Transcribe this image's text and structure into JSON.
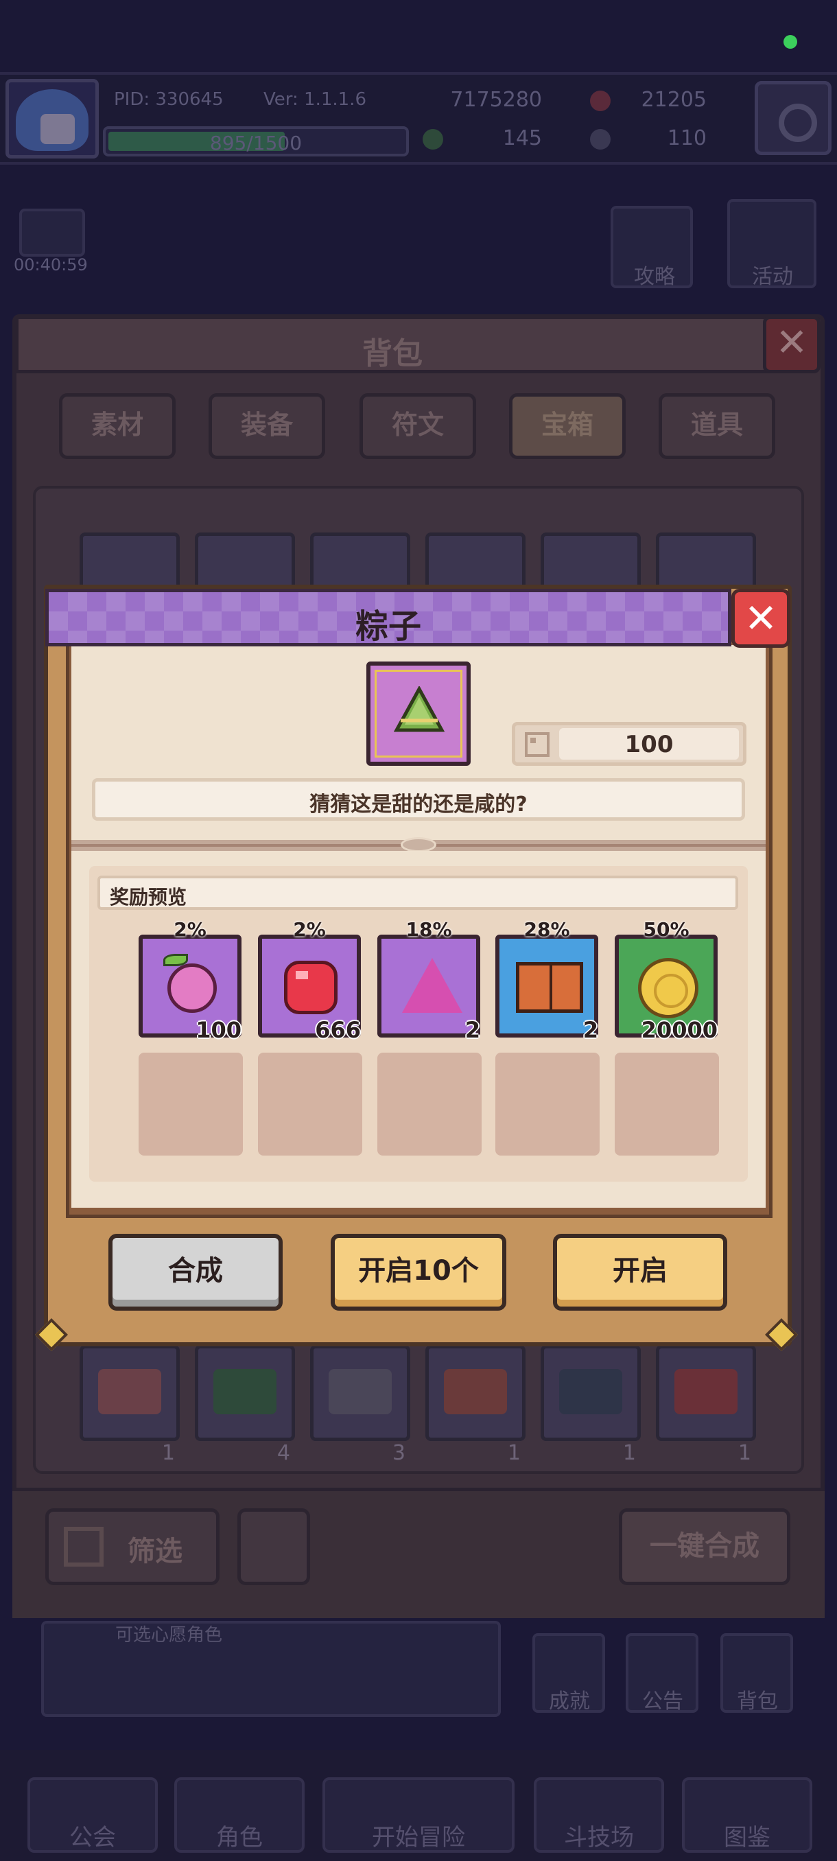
{
  "hud": {
    "pid": "PID: 330645",
    "version": "Ver: 1.1.1.6",
    "xp": "895/1500",
    "xp_fraction": 0.597,
    "gold": "7175280",
    "gems": "21205",
    "clovers": "145",
    "keys": "110",
    "timer": "00:40:59",
    "guide_label": "攻略",
    "event_label": "活动"
  },
  "backpack": {
    "title": "背包",
    "tabs": [
      "素材",
      "装备",
      "符文",
      "宝箱",
      "道具"
    ],
    "active_tab": "宝箱",
    "visible_counts": [
      "1",
      "4",
      "3",
      "1",
      "1",
      "1"
    ],
    "filter_label": "筛选",
    "merge_all_label": "一键合成"
  },
  "side_menu": {
    "achievement": "成就",
    "notice": "公告",
    "bag": "背包",
    "hint": "可选心愿角色"
  },
  "bottom_nav": {
    "guild": "公会",
    "character": "角色",
    "adventure": "开始冒险",
    "arena": "斗技场",
    "codex": "图鉴"
  },
  "modal": {
    "title": "粽子",
    "item_icon": "zongzi-icon",
    "owned_count": "100",
    "description": "猜猜这是甜的还是咸的?",
    "rewards_title": "奖励预览",
    "rewards": [
      {
        "percent": "2%",
        "qty": "100",
        "icon": "fruit-icon",
        "rarity": "purple"
      },
      {
        "percent": "2%",
        "qty": "666",
        "icon": "red-gem-icon",
        "rarity": "purple"
      },
      {
        "percent": "18%",
        "qty": "2",
        "icon": "pink-crystal-icon",
        "rarity": "purple"
      },
      {
        "percent": "28%",
        "qty": "2",
        "icon": "book-icon",
        "rarity": "blue"
      },
      {
        "percent": "50%",
        "qty": "20000",
        "icon": "gold-coin-icon",
        "rarity": "green"
      }
    ],
    "empty_slots": 5,
    "buttons": {
      "merge": "合成",
      "open_ten": "开启10个",
      "open": "开启"
    }
  },
  "colors": {
    "header_purple": "#9a70c8",
    "close_red": "#e24848",
    "button_yellow": "#f5cf82",
    "button_gray": "#d4d4d4",
    "panel_cream": "#efe2d0"
  }
}
